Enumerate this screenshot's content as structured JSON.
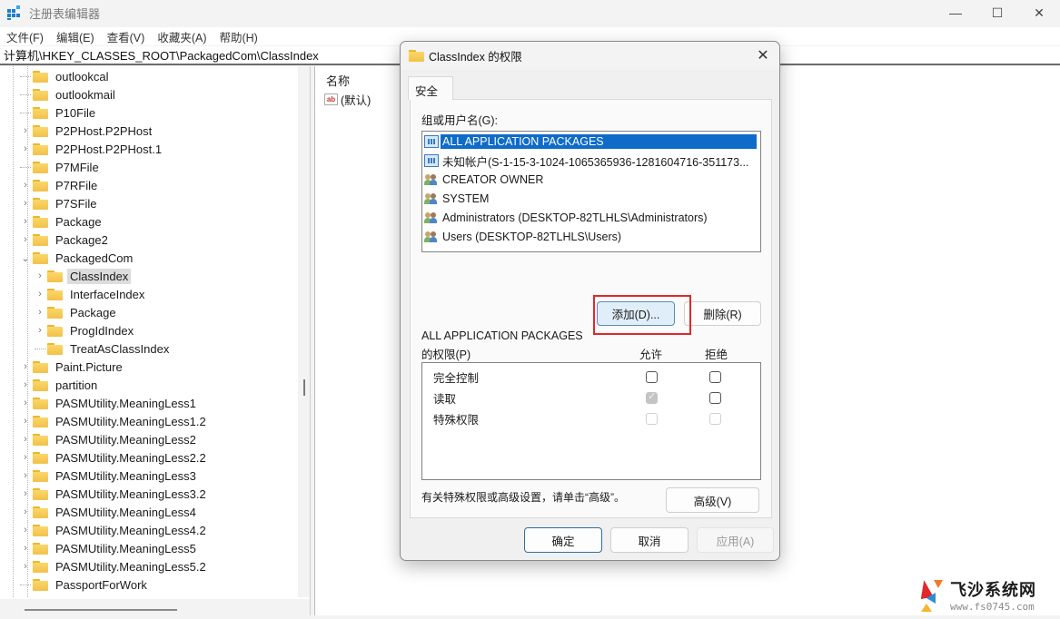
{
  "window": {
    "title": "注册表编辑器",
    "controls": {
      "minimize": "—",
      "maximize": "☐",
      "close": "✕"
    }
  },
  "menu": [
    "文件(F)",
    "编辑(E)",
    "查看(V)",
    "收藏夹(A)",
    "帮助(H)"
  ],
  "address": "计算机\\HKEY_CLASSES_ROOT\\PackagedCom\\ClassIndex",
  "tree": {
    "items": [
      {
        "label": "outlookcal",
        "level": 1,
        "expander": "none"
      },
      {
        "label": "outlookmail",
        "level": 1,
        "expander": "none"
      },
      {
        "label": "P10File",
        "level": 1,
        "expander": "none"
      },
      {
        "label": "P2PHost.P2PHost",
        "level": 1,
        "expander": "collapsed"
      },
      {
        "label": "P2PHost.P2PHost.1",
        "level": 1,
        "expander": "collapsed"
      },
      {
        "label": "P7MFile",
        "level": 1,
        "expander": "none"
      },
      {
        "label": "P7RFile",
        "level": 1,
        "expander": "collapsed"
      },
      {
        "label": "P7SFile",
        "level": 1,
        "expander": "collapsed"
      },
      {
        "label": "Package",
        "level": 1,
        "expander": "collapsed"
      },
      {
        "label": "Package2",
        "level": 1,
        "expander": "collapsed"
      },
      {
        "label": "PackagedCom",
        "level": 1,
        "expander": "expanded"
      },
      {
        "label": "ClassIndex",
        "level": 2,
        "expander": "collapsed",
        "selected": true
      },
      {
        "label": "InterfaceIndex",
        "level": 2,
        "expander": "collapsed"
      },
      {
        "label": "Package",
        "level": 2,
        "expander": "collapsed"
      },
      {
        "label": "ProgIdIndex",
        "level": 2,
        "expander": "collapsed"
      },
      {
        "label": "TreatAsClassIndex",
        "level": 2,
        "expander": "none"
      },
      {
        "label": "Paint.Picture",
        "level": 1,
        "expander": "collapsed"
      },
      {
        "label": "partition",
        "level": 1,
        "expander": "collapsed"
      },
      {
        "label": "PASMUtility.MeaningLess1",
        "level": 1,
        "expander": "collapsed"
      },
      {
        "label": "PASMUtility.MeaningLess1.2",
        "level": 1,
        "expander": "collapsed"
      },
      {
        "label": "PASMUtility.MeaningLess2",
        "level": 1,
        "expander": "collapsed"
      },
      {
        "label": "PASMUtility.MeaningLess2.2",
        "level": 1,
        "expander": "collapsed"
      },
      {
        "label": "PASMUtility.MeaningLess3",
        "level": 1,
        "expander": "collapsed"
      },
      {
        "label": "PASMUtility.MeaningLess3.2",
        "level": 1,
        "expander": "collapsed"
      },
      {
        "label": "PASMUtility.MeaningLess4",
        "level": 1,
        "expander": "collapsed"
      },
      {
        "label": "PASMUtility.MeaningLess4.2",
        "level": 1,
        "expander": "collapsed"
      },
      {
        "label": "PASMUtility.MeaningLess5",
        "level": 1,
        "expander": "collapsed"
      },
      {
        "label": "PASMUtility.MeaningLess5.2",
        "level": 1,
        "expander": "collapsed"
      },
      {
        "label": "PassportForWork",
        "level": 1,
        "expander": "none"
      }
    ]
  },
  "values": {
    "column_name": "名称",
    "rows": [
      {
        "icon": "ab",
        "name": "(默认)"
      }
    ]
  },
  "dialog": {
    "title": "ClassIndex 的权限",
    "close": "✕",
    "tab": "安全",
    "principals_label": "组或用户名(G):",
    "principals": [
      {
        "name": "ALL APPLICATION PACKAGES",
        "icon": "package",
        "selected": true
      },
      {
        "name": "未知帐户(S-1-15-3-1024-1065365936-1281604716-351173...",
        "icon": "package"
      },
      {
        "name": "CREATOR OWNER",
        "icon": "users"
      },
      {
        "name": "SYSTEM",
        "icon": "users"
      },
      {
        "name": "Administrators (DESKTOP-82TLHLS\\Administrators)",
        "icon": "users"
      },
      {
        "name": "Users (DESKTOP-82TLHLS\\Users)",
        "icon": "users"
      }
    ],
    "add_button": "添加(D)...",
    "remove_button": "删除(R)",
    "perm_title_line1": "ALL APPLICATION PACKAGES",
    "perm_title_line2": "的权限(P)",
    "allow_header": "允许",
    "deny_header": "拒绝",
    "permissions": [
      {
        "name": "完全控制",
        "allow": false,
        "deny": false,
        "allow_disabled": false,
        "deny_disabled": false
      },
      {
        "name": "读取",
        "allow": true,
        "deny": false,
        "allow_disabled": true,
        "deny_disabled": false
      },
      {
        "name": "特殊权限",
        "allow": false,
        "deny": false,
        "allow_disabled": true,
        "deny_disabled": true
      }
    ],
    "advanced_hint": "有关特殊权限或高级设置，请单击“高级”。",
    "advanced_button": "高级(V)",
    "ok_button": "确定",
    "cancel_button": "取消",
    "apply_button": "应用(A)"
  },
  "watermark": {
    "title": "飞沙系统网",
    "url": "www.fs0745.com"
  },
  "colors": {
    "selection": "#0e6bc9",
    "highlight_box": "#e0282d",
    "folder": "#f2c14a"
  }
}
